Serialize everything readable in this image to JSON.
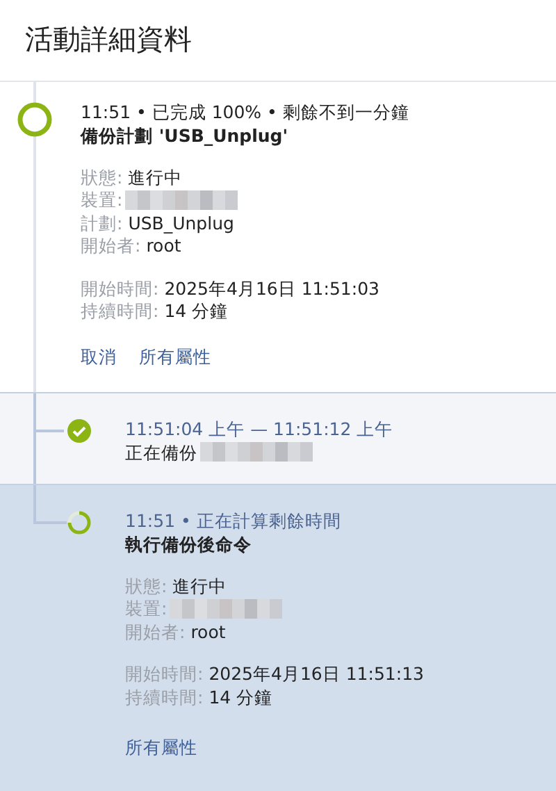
{
  "title": "活動詳細資料",
  "activity": {
    "kind": "ring",
    "headline": "11:51 • 已完成 100% • 剩餘不到一分鐘",
    "name": "備份計劃 'USB_Unplug'",
    "emphasis": true,
    "details": [
      {
        "label": "狀態:",
        "value": "進行中"
      },
      {
        "label": "裝置:",
        "redacted": true
      },
      {
        "label": "計劃:",
        "value": "USB_Unplug"
      },
      {
        "label": "開始者:",
        "value": "root"
      }
    ],
    "times": [
      {
        "label": "開始時間:",
        "value": "2025年4月16日 11:51:03"
      },
      {
        "label": "持續時間:",
        "value": "14 分鐘"
      }
    ],
    "links": [
      "取消",
      "所有屬性"
    ],
    "children": [
      {
        "kind": "check",
        "selected": false,
        "headline": "11:51:04 上午 — 11:51:12 上午",
        "name": "正在備份",
        "name_redacted": true,
        "emphasis": false
      },
      {
        "kind": "partial",
        "selected": true,
        "headline": "11:51 • 正在計算剩餘時間",
        "name": "執行備份後命令",
        "emphasis": true,
        "details": [
          {
            "label": "狀態:",
            "value": "進行中"
          },
          {
            "label": "裝置:",
            "redacted": true
          },
          {
            "label": "開始者:",
            "value": "root"
          }
        ],
        "times": [
          {
            "label": "開始時間:",
            "value": "2025年4月16日 11:51:13"
          },
          {
            "label": "持續時間:",
            "value": "14 分鐘"
          }
        ],
        "links": [
          "所有屬性"
        ]
      }
    ]
  }
}
